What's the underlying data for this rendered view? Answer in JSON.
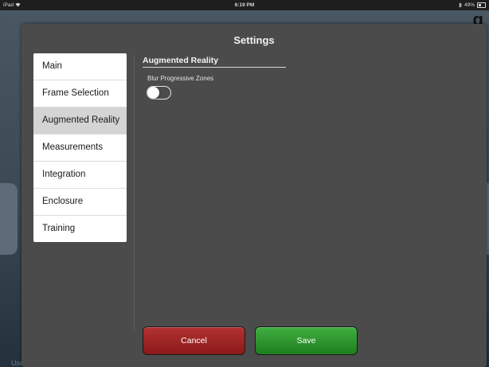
{
  "status_bar": {
    "device": "iPad",
    "time": "6:19 PM",
    "battery": "49%",
    "wifi_icon": "wifi-icon",
    "bluetooth_icon": "bluetooth-icon",
    "battery_icon": "battery-icon"
  },
  "background": {
    "top_right_title": "g",
    "bottom_left_text": "Username: tedt"
  },
  "modal": {
    "title": "Settings",
    "sidebar": {
      "items": [
        {
          "label": "Main",
          "selected": false
        },
        {
          "label": "Frame Selection",
          "selected": false
        },
        {
          "label": "Augmented Reality",
          "selected": true
        },
        {
          "label": "Measurements",
          "selected": false
        },
        {
          "label": "Integration",
          "selected": false
        },
        {
          "label": "Enclosure",
          "selected": false
        },
        {
          "label": "Training",
          "selected": false
        }
      ]
    },
    "section": {
      "header": "Augmented Reality",
      "options": [
        {
          "label": "Blur Progressive Zones",
          "enabled": false
        }
      ]
    },
    "buttons": {
      "cancel_label": "Cancel",
      "save_label": "Save"
    }
  },
  "colors": {
    "cancel": "#9e2424",
    "save": "#2f9a2f",
    "modal_bg": "#4b4b4b",
    "selected_item_bg": "#d4d4d4"
  }
}
